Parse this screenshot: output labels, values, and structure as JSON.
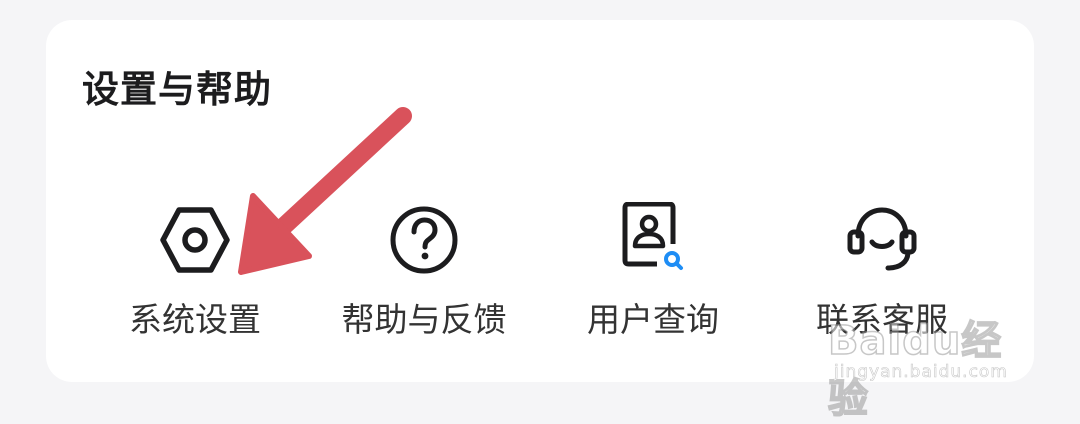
{
  "section": {
    "title": "设置与帮助",
    "items": [
      {
        "label": "系统设置",
        "icon": "hexagon-settings-icon"
      },
      {
        "label": "帮助与反馈",
        "icon": "question-circle-icon"
      },
      {
        "label": "用户查询",
        "icon": "user-search-icon"
      },
      {
        "label": "联系客服",
        "icon": "headset-icon"
      }
    ]
  },
  "watermark": {
    "logo": "Baidu经验",
    "url": "jingyan.baidu.com"
  },
  "colors": {
    "background": "#f5f5f7",
    "card": "#ffffff",
    "icon_stroke": "#1c1c1e",
    "accent_blue": "#1e8df5",
    "arrow": "#d9525b"
  }
}
